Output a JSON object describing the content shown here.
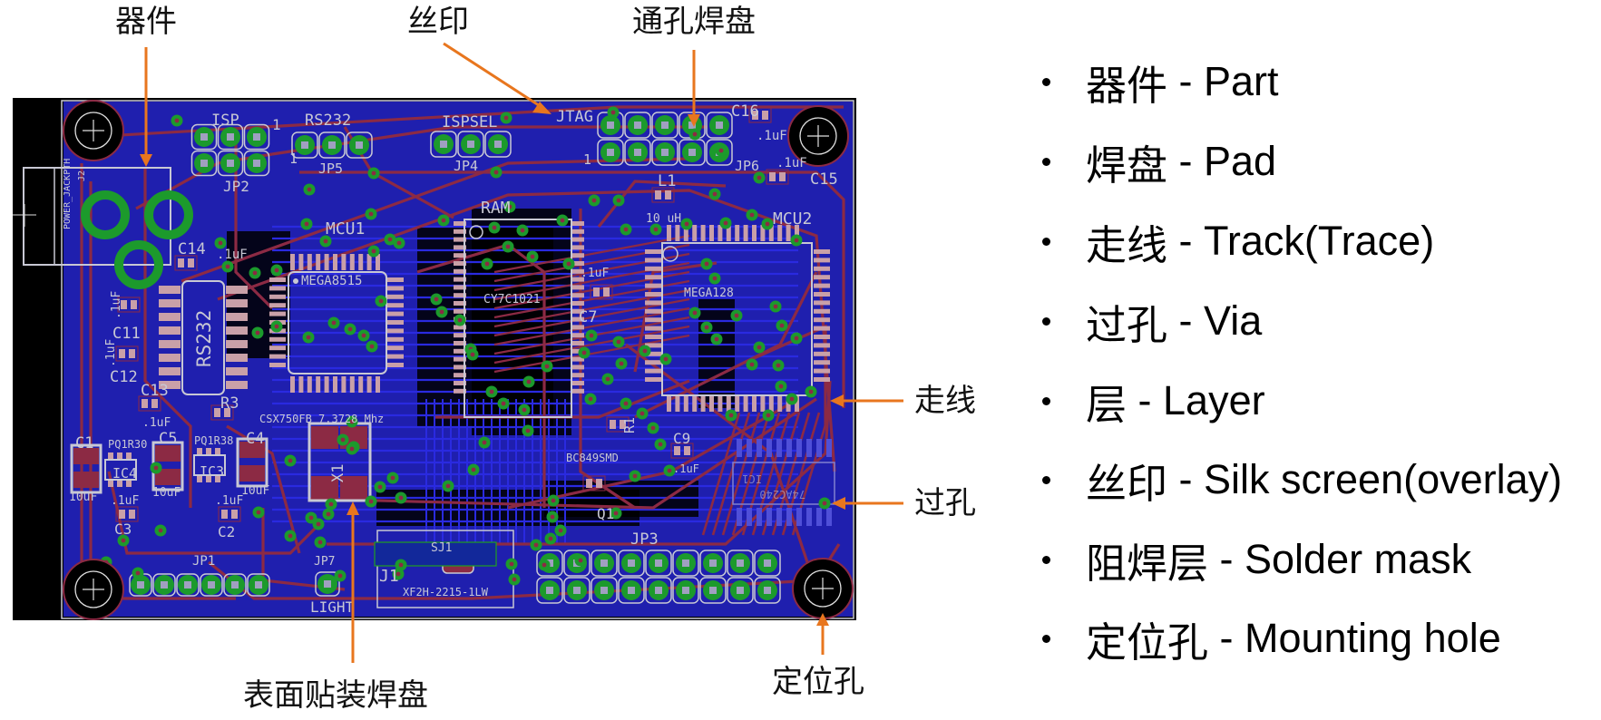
{
  "callouts": {
    "part": "器件",
    "silkscreen": "丝印",
    "through_hole_pad": "通孔焊盘",
    "track": "走线",
    "via": "过孔",
    "mounting_hole": "定位孔",
    "smd_pad": "表面贴装焊盘"
  },
  "legend": [
    {
      "zh": "器件",
      "en": "Part"
    },
    {
      "zh": "焊盘",
      "en": "Pad"
    },
    {
      "zh": "走线",
      "en": "Track(Trace)"
    },
    {
      "zh": "过孔",
      "en": "Via"
    },
    {
      "zh": "层",
      "en": "Layer"
    },
    {
      "zh": "丝印",
      "en": "Silk screen(overlay)"
    },
    {
      "zh": "阻焊层",
      "en": "Solder mask"
    },
    {
      "zh": "定位孔",
      "en": "Mounting hole"
    }
  ],
  "legend_separator": " - ",
  "pcb": {
    "labels": {
      "isp": "ISP",
      "rs232_header": "RS232",
      "ispsel": "ISPSEL",
      "jtag": "JTAG",
      "c16": "C16",
      "c16_val": ".1uF",
      "c15": "C15",
      "c15_val": ".1uF",
      "jp2": "JP2",
      "jp5": "JP5",
      "jp4": "JP4",
      "jp6": "JP6",
      "pin1_isp": "1",
      "pin1_jp5": "1",
      "pin1_jtag": "1",
      "power_jack": "POWER_JACKPTH",
      "j2": "J2",
      "c14": "C14",
      "c14_val": ".1uF",
      "mcu1": "MCU1",
      "mcu1_part": "MEGA8515",
      "ram": "RAM",
      "ram_part": "CY7C1021",
      "c7": "C7",
      "c7_val": ".1uF",
      "l1": "L1",
      "l1_val": "10 uH",
      "mcu2": "MCU2",
      "mcu2_part": "MEGA128",
      "rs232_ic": "RS232",
      "c11": "C11",
      "c11_val": ".1uF",
      "c12": "C12",
      "c12_val": ".1uF",
      "c13": "C13",
      "c13_val": ".1uF",
      "r3": "R3",
      "crystal": "CSX750FB 7.3728 Mhz",
      "x1": "X1",
      "c1": "C1",
      "c1_val": "10uF",
      "pq1r30": "PQ1R30",
      "ic4": "IC4",
      "c5": "C5",
      "c5_val": "10uF",
      "pq1r38": "PQ1R38",
      "ic3": "IC3",
      "c4": "C4",
      "c4_val": "10uF",
      "c3": "C3",
      "c3_val": ".1uF",
      "c2": "C2",
      "c2_val": ".1uF",
      "r1": "R1",
      "bc849": "BC849SMD",
      "q1": "Q1",
      "c9": "C9",
      "c9_val": ".1uF",
      "ic1": "IC1",
      "ic1_part": "74AC240",
      "jp1": "JP1",
      "jp7": "JP7",
      "light": "LIGHT",
      "sj1": "SJ1",
      "j1": "J1",
      "j1_part": "XF2H-2215-1LW",
      "jp3": "JP3"
    }
  },
  "colors": {
    "arrow": "#e8761e",
    "board_bg": "#000000",
    "copper_bottom": "#1f1fae",
    "track_top": "#8c2a44",
    "pad_green": "#1c9a2c",
    "silk": "#c8c8d4",
    "smd_pad": "#c9a0a8"
  }
}
